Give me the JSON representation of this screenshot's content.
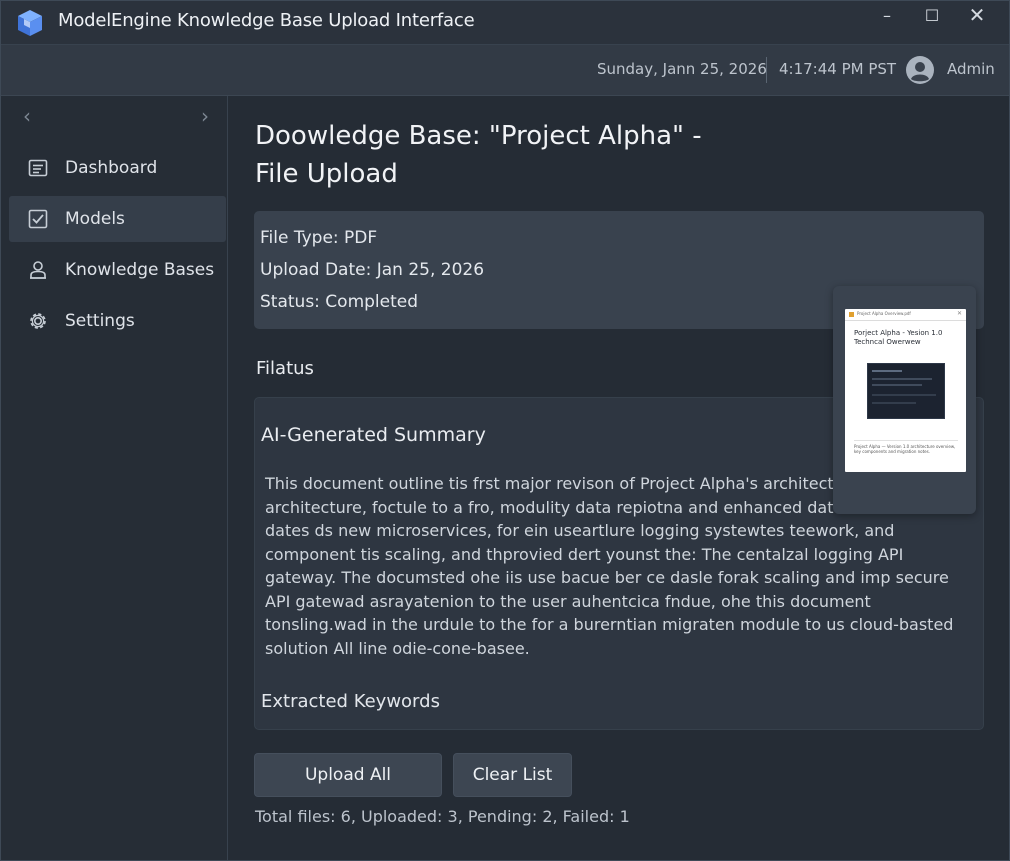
{
  "window": {
    "title": "ModelEngine Knowledge Base Upload Interface",
    "controls": {
      "minimize": "–",
      "maximize": "☐",
      "close": "✕"
    }
  },
  "header": {
    "date": "Sunday, Jann 25, 2026",
    "time": "4:17:44 PM PST",
    "user": "Admin",
    "avatar_icon": "user-avatar-icon"
  },
  "sidebar": {
    "collapse_left": "‹",
    "collapse_right": "›",
    "items": [
      {
        "label": "Dashboard",
        "icon": "dashboard-icon",
        "active": false
      },
      {
        "label": "Models",
        "icon": "checkbox-icon",
        "active": true
      },
      {
        "label": "Knowledge Bases",
        "icon": "user-icon",
        "active": false
      },
      {
        "label": "Settings",
        "icon": "gear-icon",
        "active": false
      }
    ]
  },
  "main": {
    "title_line1": "Doowledge Base: \"Project Alpha\" -",
    "title_line2": "File Upload",
    "meta": {
      "file_type": "File Type: PDF",
      "upload_date": "Upload Date: Jan 25, 2026",
      "status": "Status: Completed"
    },
    "section_label": "Filatus",
    "summary": {
      "heading": "AI-Generated Summary",
      "text": "This document outline tis frst major revison of Project Alpha's architecture c architecture, foctule to a fro, modulity data repiotna and enhanced data c enhanced dates ds new microservices, for ein useartlure logging systewtes teework, and component tis scaling, and thprovied dert younst the: The centalzal logging API gateway. The documsted ohe iis use bacue ber ce dasle forak scaling and imp secure API gatewad asrayatenion to the user auhentcica fndue, ohe this document tonsling.wad in the urdule to the for a burerntian migraten module to us cloud-basted solution All line odie-cone-basee.",
      "keywords_heading": "Extracted Keywords"
    },
    "preview": {
      "header_text": "Project Alpha Overview.pdf",
      "close": "✕",
      "doc_title": "Porject Alpha - Yesion 1.0 Techncal Owerwew",
      "caption": "Project Alpha — Version 1.0 architecture overview, key components and migration notes."
    },
    "buttons": {
      "upload_all": "Upload All",
      "clear_list": "Clear List"
    },
    "stats": "Total files: 6, Uploaded: 3, Pending: 2, Failed: 1"
  },
  "colors": {
    "window_bg": "#252c35",
    "card_bg": "#39424e",
    "accent": "#5b8def"
  }
}
